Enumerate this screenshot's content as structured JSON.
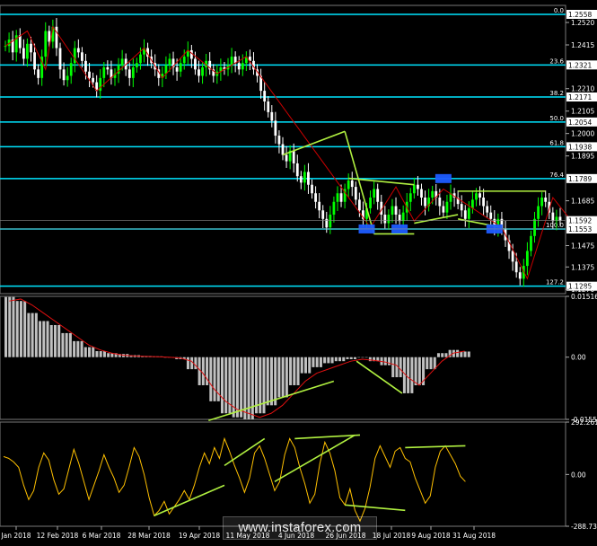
{
  "watermark": "www.instaforex.com",
  "colors": {
    "background": "#000000",
    "bull_candle": "#00ff00",
    "bear_candle": "#ffffff",
    "fib_line": "#00e5ff",
    "trend_line": "#b0f040",
    "zigzag": "#cc0000",
    "oscillator_line": "#ffc000",
    "signal_line": "#e01010",
    "hist_bar": "#c0c0c0",
    "axis_text": "#ffffff",
    "price_tag": "#ffffff",
    "divergence_box": "#1e5cff"
  },
  "chart_data": [
    {
      "type": "candlestick",
      "title": "",
      "ylim": [
        1.125,
        1.26
      ],
      "x_labels": [
        "Jan 2018",
        "12 Feb 2018",
        "6 Mar 2018",
        "28 Mar 2018",
        "19 Apr 2018",
        "11 May 2018",
        "4 Jun 2018",
        "26 Jun 2018",
        "18 Jul 2018",
        "9 Aug 2018",
        "31 Aug 2018"
      ],
      "price_ticks": [
        "1.2520",
        "1.2415",
        "1.2210",
        "1.2105",
        "1.2000",
        "1.1895",
        "1.1685",
        "1.1475",
        "1.1375",
        "1.1270"
      ],
      "current_prices": [
        "1.1592",
        "1.1553"
      ],
      "close_series": [
        1.241,
        1.244,
        1.238,
        1.246,
        1.24,
        1.235,
        1.242,
        1.238,
        1.23,
        1.226,
        1.236,
        1.248,
        1.243,
        1.25,
        1.24,
        1.23,
        1.225,
        1.227,
        1.233,
        1.24,
        1.238,
        1.234,
        1.229,
        1.226,
        1.224,
        1.22,
        1.226,
        1.231,
        1.23,
        1.226,
        1.228,
        1.232,
        1.235,
        1.23,
        1.226,
        1.231,
        1.233,
        1.237,
        1.24,
        1.236,
        1.233,
        1.23,
        1.226,
        1.228,
        1.232,
        1.235,
        1.231,
        1.229,
        1.233,
        1.236,
        1.239,
        1.235,
        1.23,
        1.227,
        1.231,
        1.234,
        1.23,
        1.227,
        1.229,
        1.231,
        1.23,
        1.232,
        1.236,
        1.233,
        1.23,
        1.233,
        1.236,
        1.234,
        1.23,
        1.227,
        1.22,
        1.215,
        1.21,
        1.206,
        1.199,
        1.195,
        1.19,
        1.187,
        1.192,
        1.186,
        1.18,
        1.177,
        1.182,
        1.176,
        1.172,
        1.168,
        1.164,
        1.16,
        1.156,
        1.162,
        1.168,
        1.172,
        1.168,
        1.174,
        1.178,
        1.175,
        1.169,
        1.164,
        1.16,
        1.165,
        1.17,
        1.174,
        1.168,
        1.162,
        1.158,
        1.162,
        1.166,
        1.162,
        1.159,
        1.163,
        1.168,
        1.172,
        1.176,
        1.174,
        1.17,
        1.166,
        1.17,
        1.173,
        1.17,
        1.166,
        1.163,
        1.168,
        1.172,
        1.17,
        1.167,
        1.164,
        1.16,
        1.165,
        1.169,
        1.172,
        1.17,
        1.166,
        1.163,
        1.16,
        1.156,
        1.16,
        1.155,
        1.15,
        1.145,
        1.14,
        1.135,
        1.132,
        1.138,
        1.145,
        1.152,
        1.16,
        1.166,
        1.17,
        1.168,
        1.163,
        1.159,
        1.161,
        1.1592
      ],
      "fib_levels": [
        {
          "label": "0.0",
          "price": 1.2558,
          "tag": "1.2558"
        },
        {
          "label": "23.6",
          "price": 1.2321,
          "tag": "1.2321"
        },
        {
          "label": "38.2",
          "price": 1.2171,
          "tag": "1.2171"
        },
        {
          "label": "50.0",
          "price": 1.2054,
          "tag": "1.2054"
        },
        {
          "label": "61.8",
          "price": 1.1938,
          "tag": "1.1938"
        },
        {
          "label": "76.4",
          "price": 1.1789,
          "tag": "1.1789"
        },
        {
          "label": "100.0",
          "price": 1.1553,
          "tag": "1.1553"
        },
        {
          "label": "127.2",
          "price": 1.1285,
          "tag": "1.1285"
        }
      ],
      "trend_lines": [
        {
          "from": [
            76,
            1.19
          ],
          "to": [
            93,
            1.201
          ]
        },
        {
          "from": [
            93,
            1.201
          ],
          "to": [
            101,
            1.153
          ]
        },
        {
          "from": [
            101,
            1.153
          ],
          "to": [
            112,
            1.153
          ]
        },
        {
          "from": [
            94,
            1.179
          ],
          "to": [
            112,
            1.176
          ]
        },
        {
          "from": [
            112,
            1.158
          ],
          "to": [
            124,
            1.162
          ]
        },
        {
          "from": [
            124,
            1.173
          ],
          "to": [
            148,
            1.173
          ]
        },
        {
          "from": [
            124,
            1.16
          ],
          "to": [
            136,
            1.156
          ]
        }
      ],
      "zigzag": [
        [
          0,
          1.241
        ],
        [
          6,
          1.248
        ],
        [
          11,
          1.23
        ],
        [
          13,
          1.25
        ],
        [
          25,
          1.22
        ],
        [
          38,
          1.24
        ],
        [
          43,
          1.226
        ],
        [
          50,
          1.239
        ],
        [
          58,
          1.228
        ],
        [
          66,
          1.236
        ],
        [
          100,
          1.156
        ],
        [
          107,
          1.175
        ],
        [
          112,
          1.159
        ],
        [
          120,
          1.174
        ],
        [
          136,
          1.156
        ],
        [
          143,
          1.132
        ],
        [
          150,
          1.17
        ],
        [
          155,
          1.1592
        ]
      ],
      "divergence_boxes": [
        [
          99,
          1.1553
        ],
        [
          108,
          1.1553
        ],
        [
          120,
          1.1789
        ],
        [
          134,
          1.1553
        ]
      ]
    },
    {
      "type": "histogram",
      "title": "",
      "ylim": [
        -0.01551,
        0.01516
      ],
      "ticks": [
        "0.01516",
        "0.00",
        "-0.01551"
      ],
      "signal_series": [
        0.014,
        0.0145,
        0.013,
        0.011,
        0.009,
        0.007,
        0.005,
        0.003,
        0.0018,
        0.001,
        0.0005,
        0.0003,
        0.0002,
        0.0001,
        0.0,
        -0.0002,
        -0.001,
        -0.004,
        -0.008,
        -0.011,
        -0.013,
        -0.014,
        -0.015,
        -0.014,
        -0.012,
        -0.009,
        -0.006,
        -0.004,
        -0.003,
        -0.002,
        -0.001,
        -0.0005,
        -0.0008,
        -0.0012,
        -0.002,
        -0.005,
        -0.007,
        -0.004,
        -0.001,
        0.001,
        0.0015
      ],
      "hist_series": [
        0.015,
        0.014,
        0.011,
        0.009,
        0.008,
        0.006,
        0.004,
        0.0025,
        0.0015,
        0.001,
        0.0008,
        0.0005,
        0.0003,
        0.0002,
        0.0,
        -0.0005,
        -0.003,
        -0.007,
        -0.011,
        -0.014,
        -0.015,
        -0.0155,
        -0.014,
        -0.012,
        -0.01,
        -0.007,
        -0.004,
        -0.0025,
        -0.0015,
        -0.001,
        -0.0005,
        0.0,
        -0.001,
        -0.002,
        -0.005,
        -0.009,
        -0.007,
        -0.003,
        0.001,
        0.0018,
        0.0014
      ]
    },
    {
      "type": "line",
      "title": "",
      "ylim": [
        -288.7301,
        292.2619
      ],
      "ticks": [
        "292.2619",
        "0.00",
        "-288.7301"
      ],
      "values": [
        100,
        90,
        70,
        40,
        -60,
        -140,
        -90,
        40,
        120,
        80,
        -30,
        -110,
        -80,
        30,
        140,
        60,
        -40,
        -140,
        -60,
        20,
        110,
        40,
        -20,
        -100,
        -60,
        40,
        150,
        100,
        0,
        -130,
        -230,
        -200,
        -150,
        -220,
        -180,
        -140,
        -90,
        -140,
        -60,
        40,
        120,
        60,
        150,
        90,
        200,
        130,
        50,
        -20,
        -100,
        -20,
        120,
        160,
        90,
        0,
        -90,
        -40,
        110,
        200,
        150,
        40,
        -50,
        -160,
        -110,
        60,
        180,
        120,
        20,
        -130,
        -170,
        -80,
        -200,
        -260,
        -190,
        -70,
        90,
        160,
        100,
        40,
        130,
        150,
        90,
        70,
        -20,
        -90,
        -160,
        -120,
        40,
        130,
        160,
        110,
        60,
        -10,
        -40
      ]
    }
  ]
}
